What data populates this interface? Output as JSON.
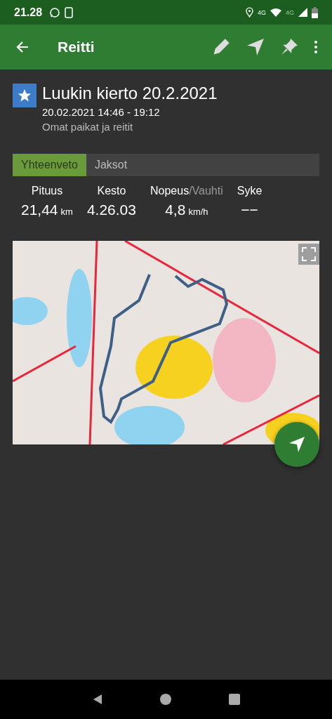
{
  "status_bar": {
    "time": "21.28",
    "network_labels": [
      "4G",
      "4G"
    ]
  },
  "app_bar": {
    "title": "Reitti"
  },
  "route": {
    "name": "Luukin kierto 20.2.2021",
    "time_range": "20.02.2021 14:46 - 19:12",
    "folder": "Omat paikat ja reitit"
  },
  "tabs": [
    {
      "label": "Yhteenveto",
      "selected": true
    },
    {
      "label": "Jaksot",
      "selected": false
    }
  ],
  "stats": [
    {
      "label": "Pituus",
      "value": "21,44",
      "unit": "km"
    },
    {
      "label": "Kesto",
      "value": "4.26.03"
    },
    {
      "label": "Nopeus",
      "label_alt": "/Vauhti",
      "value": "4,8",
      "unit": "km/h"
    },
    {
      "label": "Syke",
      "value": "−−"
    }
  ]
}
